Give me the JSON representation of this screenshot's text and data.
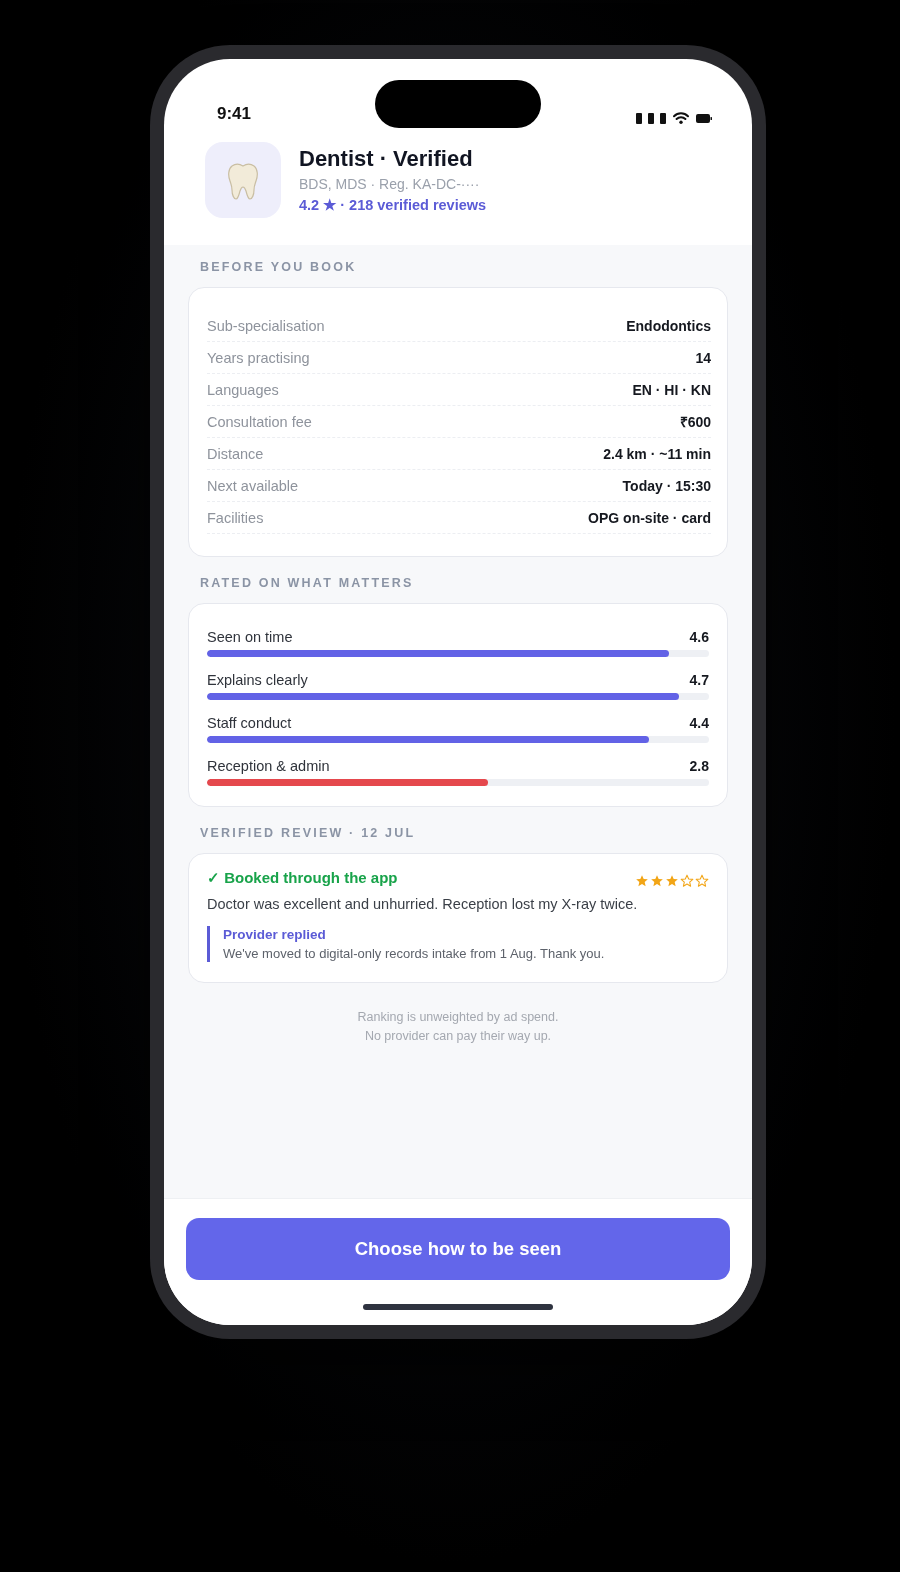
{
  "status_bar": {
    "time": "9:41"
  },
  "header": {
    "title": "Dentist · Verified",
    "subtitle": "BDS, MDS · Reg. KA-DC-····",
    "rating": "4.2 ★ · 218 verified reviews"
  },
  "before_you_book": {
    "title": "BEFORE YOU BOOK",
    "rows": [
      {
        "label": "Sub-specialisation",
        "value": "Endodontics"
      },
      {
        "label": "Years practising",
        "value": "14"
      },
      {
        "label": "Languages",
        "value": "EN · HI · KN"
      },
      {
        "label": "Consultation fee",
        "value": "₹600"
      },
      {
        "label": "Distance",
        "value": "2.4 km · ~11 min"
      },
      {
        "label": "Next available",
        "value": "Today · 15:30"
      },
      {
        "label": "Facilities",
        "value": "OPG on-site · card"
      }
    ]
  },
  "ratings": {
    "title": "RATED ON WHAT MATTERS",
    "items": [
      {
        "label": "Seen on time",
        "value": "4.6",
        "level": 0.92,
        "color": "#6262e6"
      },
      {
        "label": "Explains clearly",
        "value": "4.7",
        "level": 0.94,
        "color": "#6262e6"
      },
      {
        "label": "Staff conduct",
        "value": "4.4",
        "level": 0.88,
        "color": "#6262e6"
      },
      {
        "label": "Reception & admin",
        "value": "2.8",
        "level": 0.56,
        "color": "#e5484d"
      }
    ]
  },
  "review": {
    "title": "VERIFIED REVIEW · 12 JUL",
    "badge": "✓ Booked through the app",
    "stars": 3,
    "text": "Doctor was excellent and unhurried. Reception lost my X-ray twice.",
    "reply": {
      "title": "Provider replied",
      "text": "We've moved to digital-only records intake from 1 Aug. Thank you."
    }
  },
  "footnote": [
    "Ranking is unweighted by ad spend.",
    "No provider can pay their way up."
  ],
  "cta": {
    "label": "Choose how to be seen"
  }
}
